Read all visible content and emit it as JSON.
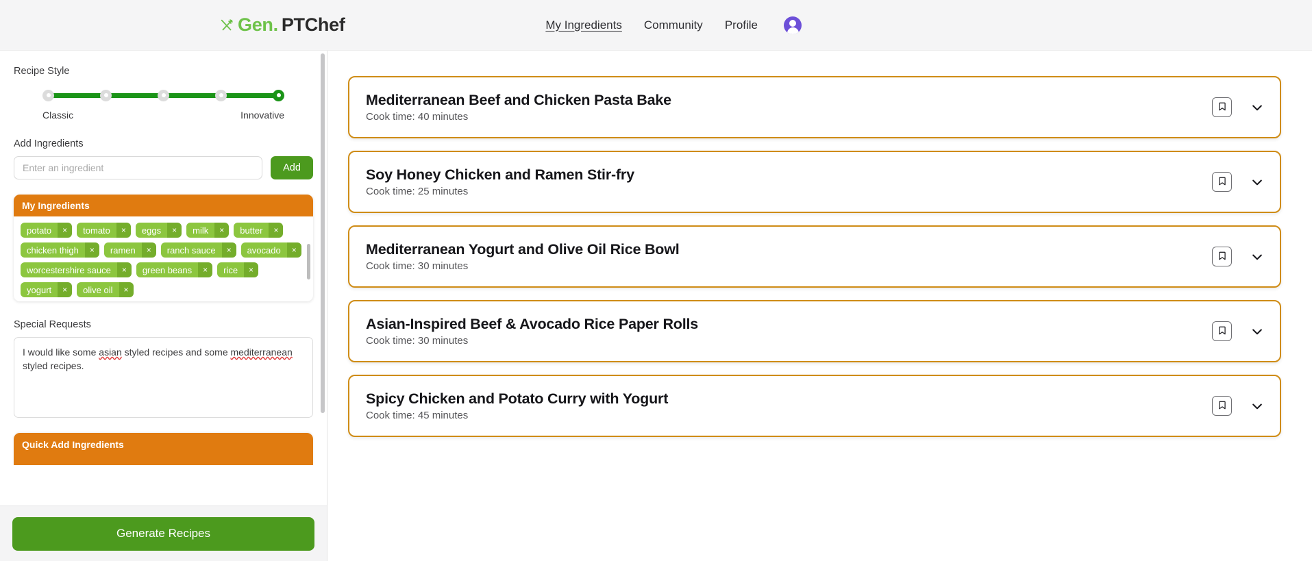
{
  "header": {
    "brand_icon": "crossed-utensils-icon",
    "brand_prefix": "Gen.",
    "brand_suffix": "PTChef",
    "nav": [
      {
        "label": "My Ingredients",
        "active": true
      },
      {
        "label": "Community",
        "active": false
      },
      {
        "label": "Profile",
        "active": false
      }
    ],
    "avatar_icon": "user-avatar-icon",
    "avatar_color": "#6c4fd8",
    "background": "#f5f5f6"
  },
  "sidebar": {
    "recipe_style": {
      "label": "Recipe Style",
      "steps": 5,
      "selected_index": 4,
      "min_label": "Classic",
      "max_label": "Innovative",
      "track_color": "#1b9418",
      "dot_color": "#dcdcdc"
    },
    "add_ingredients": {
      "label": "Add Ingredients",
      "placeholder": "Enter an ingredient",
      "value": "",
      "add_label": "Add",
      "button_color": "#4c9a1e"
    },
    "my_ingredients": {
      "title": "My Ingredients",
      "header_color": "#e07b10",
      "remove_glyph": "×",
      "items": [
        "potato",
        "tomato",
        "eggs",
        "milk",
        "butter",
        "chicken thigh",
        "ramen",
        "ranch sauce",
        "avocado",
        "worcestershire sauce",
        "green beans",
        "rice",
        "yogurt",
        "olive oil"
      ]
    },
    "special_requests": {
      "label": "Special Requests",
      "value": "I would like some asian styled recipes and some mediterranean styled recipes.",
      "part_1": "I would like some ",
      "misspelled_1": "asian",
      "part_2": " styled recipes and some ",
      "misspelled_2": "mediterranean",
      "part_3": " styled recipes."
    },
    "quick_add": {
      "title": "Quick Add Ingredients",
      "header_color": "#e07b10"
    },
    "generate": {
      "label": "Generate Recipes",
      "button_color": "#4c9a1e"
    }
  },
  "main": {
    "card_border_color": "#cf8c16",
    "bookmark_icon": "bookmark-icon",
    "expand_icon": "chevron-down-icon",
    "recipes": [
      {
        "title": "Mediterranean Beef and Chicken Pasta Bake",
        "cook_time": "Cook time: 40 minutes"
      },
      {
        "title": "Soy Honey Chicken and Ramen Stir-fry",
        "cook_time": "Cook time: 25 minutes"
      },
      {
        "title": "Mediterranean Yogurt and Olive Oil Rice Bowl",
        "cook_time": "Cook time: 30 minutes"
      },
      {
        "title": "Asian-Inspired Beef & Avocado Rice Paper Rolls",
        "cook_time": "Cook time: 30 minutes"
      },
      {
        "title": "Spicy Chicken and Potato Curry with Yogurt",
        "cook_time": "Cook time: 45 minutes"
      }
    ]
  }
}
